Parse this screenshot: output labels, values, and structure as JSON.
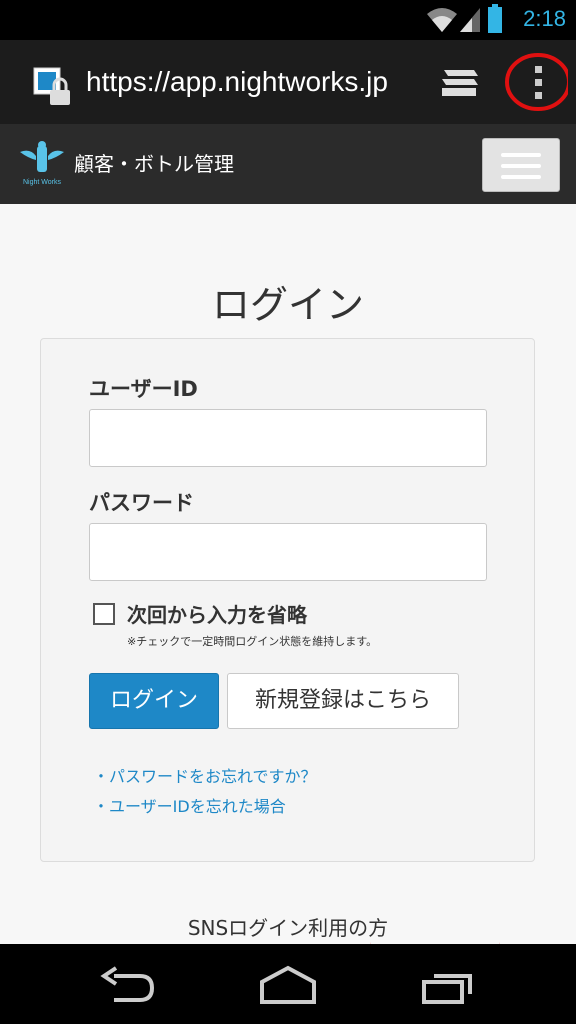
{
  "status_bar": {
    "time": "2:18"
  },
  "browser": {
    "url": "https://app.nightworks.jp"
  },
  "app_header": {
    "logo_text": "Night Works",
    "title": "顧客・ボトル管理"
  },
  "login": {
    "page_title": "ログイン",
    "user_id_label": "ユーザーID",
    "user_id_value": "",
    "password_label": "パスワード",
    "password_value": "",
    "remember_label": "次回から入力を省略",
    "remember_note": "※チェックで一定時間ログイン状態を維持します。",
    "remember_checked": false,
    "login_button": "ログイン",
    "register_button": "新規登録はこちら",
    "forgot_password_link": "・パスワードをお忘れですか？",
    "forgot_id_link": "・ユーザーIDを忘れた場合"
  },
  "sns_section": {
    "label": "SNSログイン利用の方"
  },
  "colors": {
    "accent": "#1e88c7",
    "status_blue": "#33b5e5",
    "annotation_red": "#e01010"
  },
  "icons": [
    "wifi-icon",
    "signal-icon",
    "battery-icon",
    "lock-icon",
    "tabs-icon",
    "overflow-menu-icon",
    "hamburger-icon",
    "back-icon",
    "home-icon",
    "recent-apps-icon"
  ]
}
